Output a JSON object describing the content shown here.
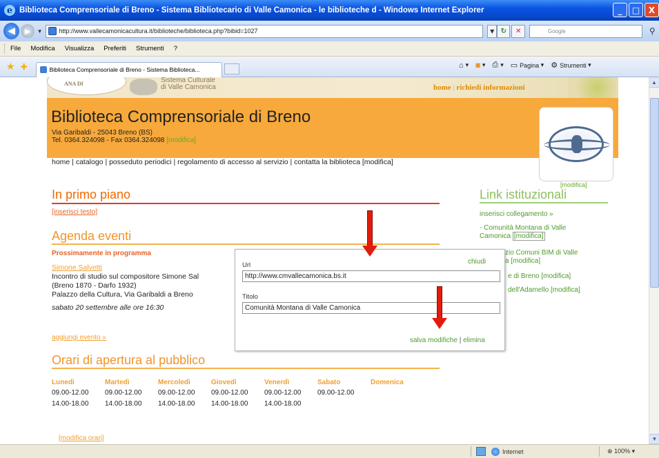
{
  "window": {
    "title": "Biblioteca Comprensoriale di Breno - Sistema Bibliotecario di Valle Camonica - le biblioteche d - Windows Internet Explorer",
    "min": "_",
    "max": "□",
    "close": "X"
  },
  "address": {
    "url": "http://www.vallecamonicacultura.it/biblioteche/biblioteca.php?bibid=1027",
    "search_placeholder": "Google"
  },
  "menu": [
    "File",
    "Modifica",
    "Visualizza",
    "Preferiti",
    "Strumenti",
    "?"
  ],
  "tab": {
    "label": "Biblioteca Comprensoriale di Breno - Sistema Biblioteca..."
  },
  "commandbar": {
    "pagina": "Pagina",
    "strumenti": "Strumenti"
  },
  "page": {
    "banner": {
      "sistema_line1": "Sistema Culturale",
      "sistema_line2": "di Valle Camonica",
      "logo_text": "ANA DI",
      "home": "home",
      "separator": "|",
      "richiedi": "richiedi informazioni"
    },
    "header": {
      "name": "Biblioteca Comprensoriale di Breno",
      "address": "Via Garibaldi - 25043 Breno (BS)",
      "phone": "Tel. 0364.324098 - Fax 0364.324098",
      "modifica": "[modifica]",
      "logo_modifica": "[modifica]"
    },
    "topnav": "home | catalogo | posseduto periodici | regolamento di accesso al servizio | contatta la biblioteca [modifica]",
    "in_primo_piano": {
      "title": "In primo piano",
      "insert": "[inserisci testo]"
    },
    "agenda": {
      "title": "Agenda eventi",
      "subtitle": "Prossimamente in programma",
      "event_link": "Simone Salvetti",
      "event_line1": "Incontro di studio sul compositore Simone Sal",
      "event_line2": "(Breno 1870 - Darfo 1932)",
      "event_line3": "Palazzo della Cultura, Via Garibaldi a Breno",
      "event_date": "sabato 20 settembre alle ore 16:30",
      "add": "aggiungi evento »"
    },
    "orari": {
      "title": "Orari di apertura al pubblico",
      "days": [
        "Lunedì",
        "Martedì",
        "Mercoledì",
        "Giovedì",
        "Venerdì",
        "Sabato",
        "Domenica"
      ],
      "rows": [
        [
          "09.00-12.00",
          "09.00-12.00",
          "09.00-12.00",
          "09.00-12.00",
          "09.00-12.00",
          "09.00-12.00",
          ""
        ],
        [
          "14.00-18.00",
          "14.00-18.00",
          "14.00-18.00",
          "14.00-18.00",
          "14.00-18.00",
          "",
          ""
        ]
      ],
      "modifica": "[modifica orari]"
    },
    "links": {
      "title": "Link istituzionali",
      "insert": "inserisci collegamento »",
      "item1_a": "- Comunità Montana di Valle",
      "item1_b": "Camonica",
      "item2_a": "zio Comuni BIM di Valle",
      "item2_b": "a",
      "item3": "e di Breno",
      "item4": "dell'Adamello",
      "modifica": "[modifica]"
    },
    "popup": {
      "url_label": "Url",
      "url_value": "http://www.cmvallecamonica.bs.it",
      "title_label": "Titolo",
      "title_value": "Comunità Montana di Valle Camonica",
      "close": "chiudi",
      "save": "salva modifiche",
      "separator": "|",
      "delete": "elimina"
    }
  },
  "status": {
    "zone": "Internet",
    "zoom": "100%"
  },
  "colors": {
    "orange_header": "#f7a93b",
    "section_orange": "#ee6a00",
    "link_green": "#4f9a2a",
    "annotation_arrow": "#e31b0c"
  }
}
